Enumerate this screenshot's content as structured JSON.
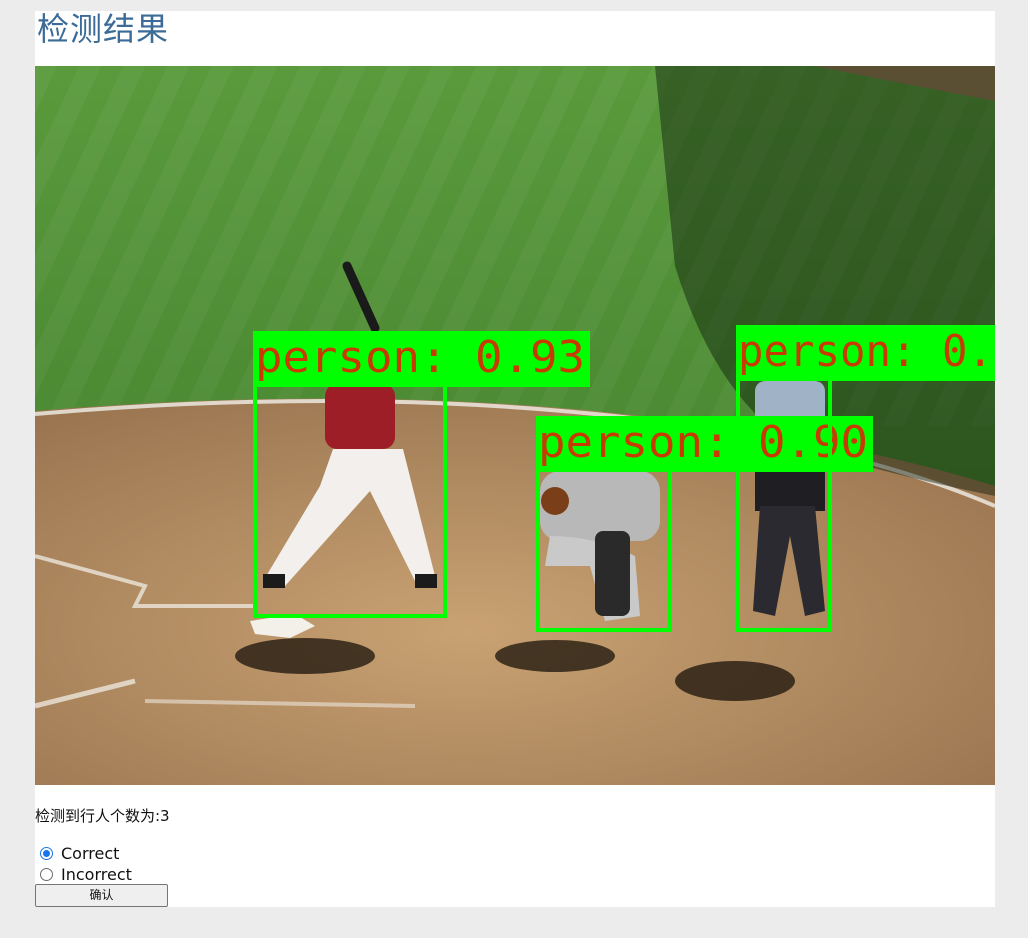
{
  "page": {
    "title": "检测结果"
  },
  "detections": [
    {
      "label": "person: 0.93"
    },
    {
      "label": "person: 0.90"
    },
    {
      "label": "person: 0."
    }
  ],
  "summary": {
    "count_text": "检测到行人个数为:3",
    "count": 3
  },
  "feedback": {
    "options": [
      {
        "label": "Correct",
        "checked": true
      },
      {
        "label": "Incorrect",
        "checked": false
      }
    ],
    "confirm_label": "确认"
  },
  "colors": {
    "background": "#ececec",
    "panel": "#ffffff",
    "title": "#3b6b96",
    "detection_box": "#00ff00",
    "detection_text": "#c83a00",
    "radio_accent": "#1a73e8"
  }
}
